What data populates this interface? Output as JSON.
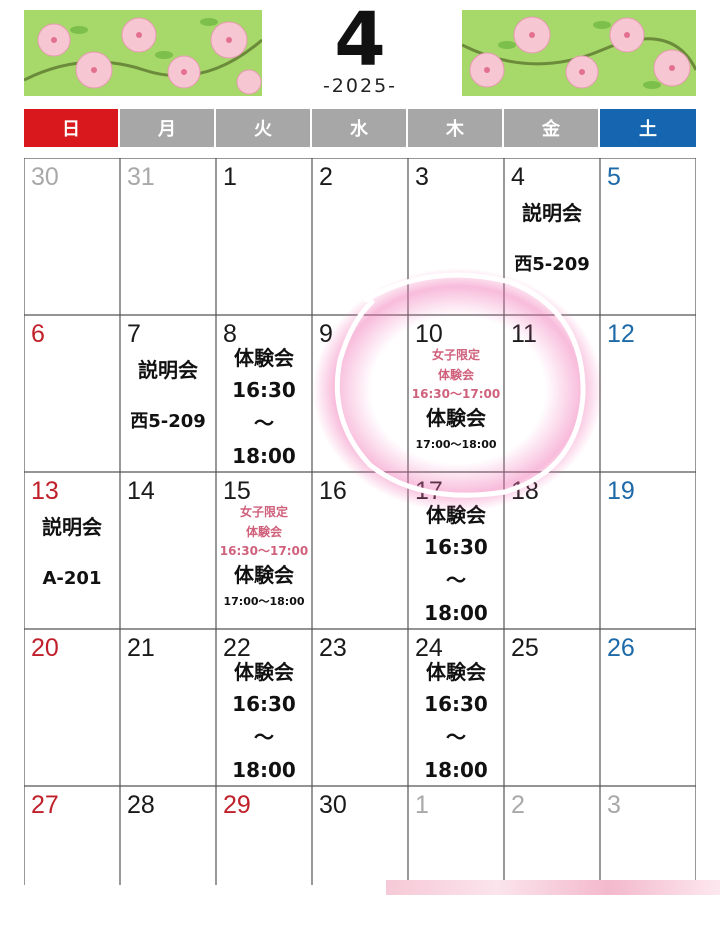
{
  "header": {
    "month": "4",
    "year": "-2025-"
  },
  "weekdays": [
    {
      "label": "日",
      "color": "#d8181c"
    },
    {
      "label": "月",
      "color": "#a7a7a7"
    },
    {
      "label": "火",
      "color": "#a7a7a7"
    },
    {
      "label": "水",
      "color": "#a7a7a7"
    },
    {
      "label": "木",
      "color": "#a7a7a7"
    },
    {
      "label": "金",
      "color": "#a7a7a7"
    },
    {
      "label": "土",
      "color": "#1565b0"
    }
  ],
  "colors": {
    "sunday": "#c0202a",
    "saturday": "#1e6aa8",
    "weekday": "#1a1a1a",
    "muted": "#a9a9a9",
    "pink_note": "#d0617c",
    "highlight_circle": "#ffffff",
    "highlight_glow": "#f06ab0"
  },
  "weeks": [
    [
      {
        "day": "30",
        "tone": "muted"
      },
      {
        "day": "31",
        "tone": "muted"
      },
      {
        "day": "1",
        "tone": "weekday"
      },
      {
        "day": "2",
        "tone": "weekday"
      },
      {
        "day": "3",
        "tone": "weekday"
      },
      {
        "day": "4",
        "tone": "weekday",
        "event": {
          "title": "説明会",
          "room": "西5-209"
        }
      },
      {
        "day": "5",
        "tone": "saturday"
      }
    ],
    [
      {
        "day": "6",
        "tone": "sunday"
      },
      {
        "day": "7",
        "tone": "weekday",
        "event": {
          "title": "説明会",
          "room": "西5-209"
        }
      },
      {
        "day": "8",
        "tone": "weekday",
        "event": {
          "title": "体験会",
          "start": "16:30",
          "sep": "〜",
          "end": "18:00"
        }
      },
      {
        "day": "9",
        "tone": "weekday"
      },
      {
        "day": "10",
        "tone": "weekday",
        "special": {
          "note1": "女子限定",
          "note2": "体験会",
          "note_time": "16:30〜17:00",
          "title": "体験会",
          "time": "17:00〜18:00"
        }
      },
      {
        "day": "11",
        "tone": "weekday"
      },
      {
        "day": "12",
        "tone": "saturday"
      }
    ],
    [
      {
        "day": "13",
        "tone": "sunday",
        "event": {
          "title": "説明会",
          "room": "A-201"
        }
      },
      {
        "day": "14",
        "tone": "weekday"
      },
      {
        "day": "15",
        "tone": "weekday",
        "special": {
          "note1": "女子限定",
          "note2": "体験会",
          "note_time": "16:30〜17:00",
          "title": "体験会",
          "time": "17:00〜18:00"
        }
      },
      {
        "day": "16",
        "tone": "weekday"
      },
      {
        "day": "17",
        "tone": "weekday",
        "event": {
          "title": "体験会",
          "start": "16:30",
          "sep": "〜",
          "end": "18:00"
        }
      },
      {
        "day": "18",
        "tone": "weekday"
      },
      {
        "day": "19",
        "tone": "saturday"
      }
    ],
    [
      {
        "day": "20",
        "tone": "sunday"
      },
      {
        "day": "21",
        "tone": "weekday"
      },
      {
        "day": "22",
        "tone": "weekday",
        "event": {
          "title": "体験会",
          "start": "16:30",
          "sep": "〜",
          "end": "18:00"
        }
      },
      {
        "day": "23",
        "tone": "weekday"
      },
      {
        "day": "24",
        "tone": "weekday",
        "event": {
          "title": "体験会",
          "start": "16:30",
          "sep": "〜",
          "end": "18:00"
        }
      },
      {
        "day": "25",
        "tone": "weekday"
      },
      {
        "day": "26",
        "tone": "saturday"
      }
    ],
    [
      {
        "day": "27",
        "tone": "sunday"
      },
      {
        "day": "28",
        "tone": "weekday"
      },
      {
        "day": "29",
        "tone": "sunday"
      },
      {
        "day": "30",
        "tone": "weekday"
      },
      {
        "day": "1",
        "tone": "muted"
      },
      {
        "day": "2",
        "tone": "muted"
      },
      {
        "day": "3",
        "tone": "muted"
      }
    ]
  ]
}
